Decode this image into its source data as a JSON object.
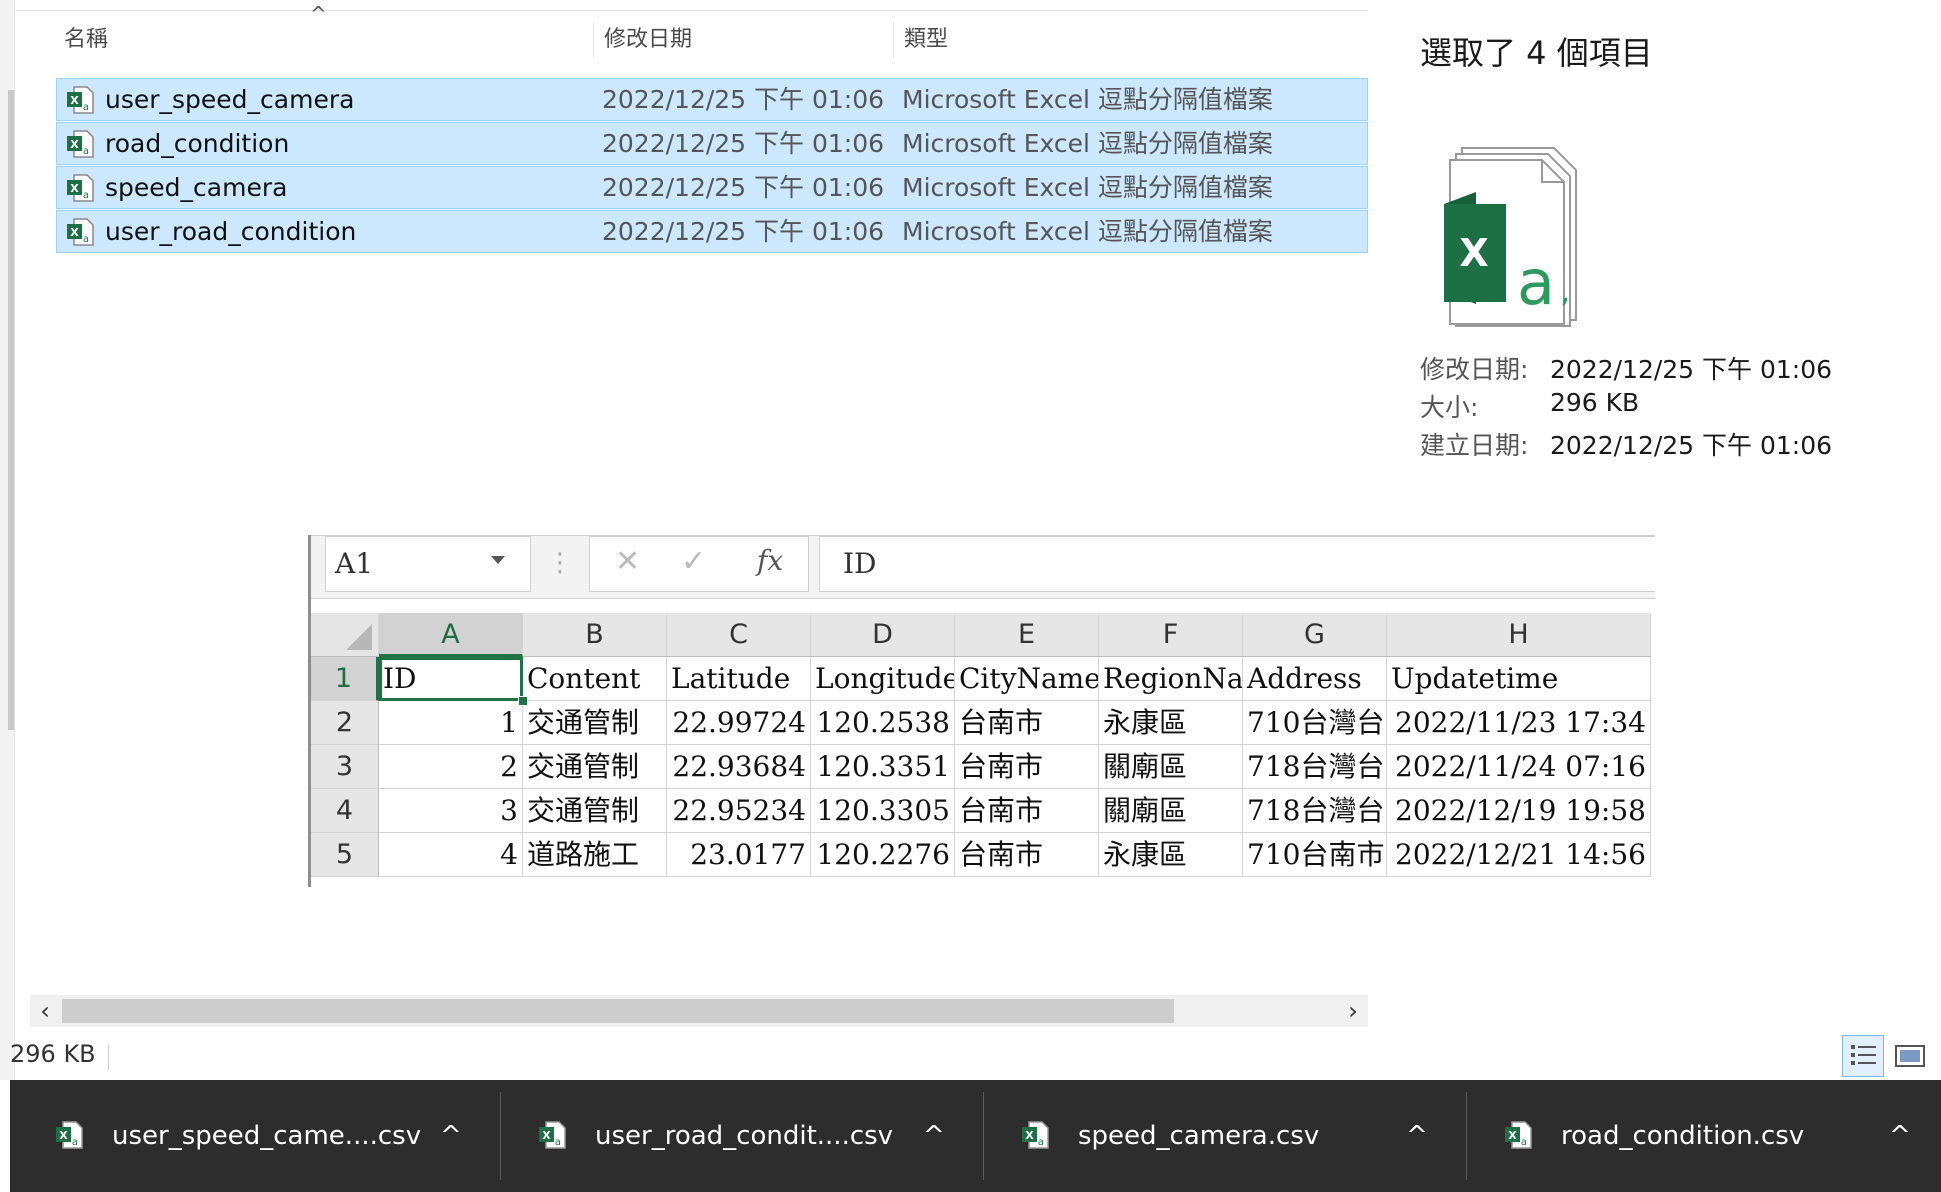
{
  "explorer": {
    "columns": {
      "name": "名稱",
      "date": "修改日期",
      "type": "類型"
    },
    "files": [
      {
        "name": "user_speed_camera",
        "date": "2022/12/25 下午 01:06",
        "type": "Microsoft Excel 逗點分隔值檔案"
      },
      {
        "name": "road_condition",
        "date": "2022/12/25 下午 01:06",
        "type": "Microsoft Excel 逗點分隔值檔案"
      },
      {
        "name": "speed_camera",
        "date": "2022/12/25 下午 01:06",
        "type": "Microsoft Excel 逗點分隔值檔案"
      },
      {
        "name": "user_road_condition",
        "date": "2022/12/25 下午 01:06",
        "type": "Microsoft Excel 逗點分隔值檔案"
      }
    ],
    "status_size": "296 KB"
  },
  "details": {
    "title": "選取了 4 個項目",
    "modified_label": "修改日期:",
    "modified_value": "2022/12/25 下午 01:06",
    "size_label": "大小:",
    "size_value": "296 KB",
    "created_label": "建立日期:",
    "created_value": "2022/12/25 下午 01:06"
  },
  "excel": {
    "name_box": "A1",
    "formula": "ID",
    "columns": [
      "A",
      "B",
      "C",
      "D",
      "E",
      "F",
      "G",
      "H"
    ],
    "rows": [
      {
        "n": "1",
        "cells": [
          "ID",
          "Content",
          "Latitude",
          "Longitude",
          "CityName",
          "RegionNan",
          "Address",
          "Updatetime"
        ]
      },
      {
        "n": "2",
        "cells": [
          "1",
          "交通管制",
          "22.99724",
          "120.2538",
          "台南市",
          "永康區",
          "710台灣台",
          "2022/11/23 17:34"
        ]
      },
      {
        "n": "3",
        "cells": [
          "2",
          "交通管制",
          "22.93684",
          "120.3351",
          "台南市",
          "關廟區",
          "718台灣台",
          "2022/11/24 07:16"
        ]
      },
      {
        "n": "4",
        "cells": [
          "3",
          "交通管制",
          "22.95234",
          "120.3305",
          "台南市",
          "關廟區",
          "718台灣台",
          "2022/12/19 19:58"
        ]
      },
      {
        "n": "5",
        "cells": [
          "4",
          "道路施工",
          "23.0177",
          "120.2276",
          "台南市",
          "永康區",
          "710台南市",
          "2022/12/21 14:56"
        ]
      }
    ]
  },
  "taskbar": {
    "downloads": [
      {
        "label": "user_speed_came....csv"
      },
      {
        "label": "user_road_condit....csv"
      },
      {
        "label": "speed_camera.csv"
      },
      {
        "label": "road_condition.csv"
      }
    ],
    "caret": "^"
  },
  "colors": {
    "selection_bg": "#cce8ff",
    "selection_border": "#99d1ff",
    "excel_green": "#217346",
    "taskbar_bg": "#2d2d2d"
  },
  "icons": {
    "file": "csv-file-icon",
    "large": "excel-stack-icon",
    "sort": "sort-ascending-icon"
  }
}
